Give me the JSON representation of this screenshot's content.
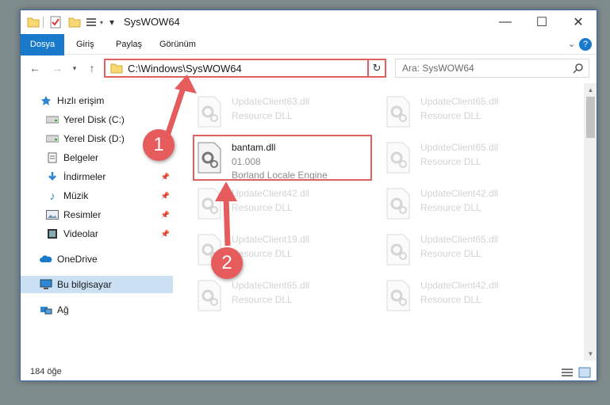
{
  "window": {
    "title": "SysWOW64"
  },
  "ribbon": {
    "tabs": [
      "Dosya",
      "Giriş",
      "Paylaş",
      "Görünüm"
    ]
  },
  "address": {
    "path": "C:\\Windows\\SysWOW64",
    "search_placeholder": "Ara: SysWOW64"
  },
  "nav": {
    "items": [
      {
        "label": "Hızlı erişim",
        "icon": "star-icon"
      },
      {
        "label": "Yerel Disk (C:)",
        "icon": "drive-icon"
      },
      {
        "label": "Yerel Disk (D:)",
        "icon": "drive-icon"
      },
      {
        "label": "Belgeler",
        "icon": "documents-icon"
      },
      {
        "label": "İndirmeler",
        "icon": "download-icon"
      },
      {
        "label": "Müzik",
        "icon": "music-icon"
      },
      {
        "label": "Resimler",
        "icon": "pictures-icon"
      },
      {
        "label": "Videolar",
        "icon": "videos-icon"
      },
      {
        "label": "OneDrive",
        "icon": "cloud-icon"
      },
      {
        "label": "Bu bilgisayar",
        "icon": "computer-icon"
      },
      {
        "label": "Ağ",
        "icon": "network-icon"
      }
    ]
  },
  "files": {
    "highlighted": {
      "name": "bantam.dll",
      "version": "01.008",
      "description": "Borland Locale Engine"
    },
    "left_column": [
      {
        "name": "UpdateClient63.dll",
        "desc": "Resource DLL"
      },
      {
        "name": "UpdateClient42.dll",
        "desc": "Resource DLL"
      },
      {
        "name": "UpdateClient19.dll",
        "desc": "Resource DLL"
      },
      {
        "name": "UpdateClient65.dll",
        "desc": "Resource DLL"
      }
    ],
    "right_column": [
      {
        "name": "UpdateClient65.dll",
        "desc": "Resource DLL"
      },
      {
        "name": "UpdateClient65.dll",
        "desc": "Resource DLL"
      },
      {
        "name": "UpdateClient42.dll",
        "desc": "Resource DLL"
      },
      {
        "name": "UpdateClient65.dll",
        "desc": "Resource DLL"
      },
      {
        "name": "UpdateClient42.dll",
        "desc": "Resource DLL"
      }
    ]
  },
  "status": {
    "item_count": "184 öğe"
  },
  "annotations": {
    "marker_1": "1",
    "marker_2": "2"
  },
  "colors": {
    "accent": "#1979ca",
    "highlight": "#e05f5f",
    "marker": "#e65b5b",
    "selected": "#cce0f4"
  }
}
